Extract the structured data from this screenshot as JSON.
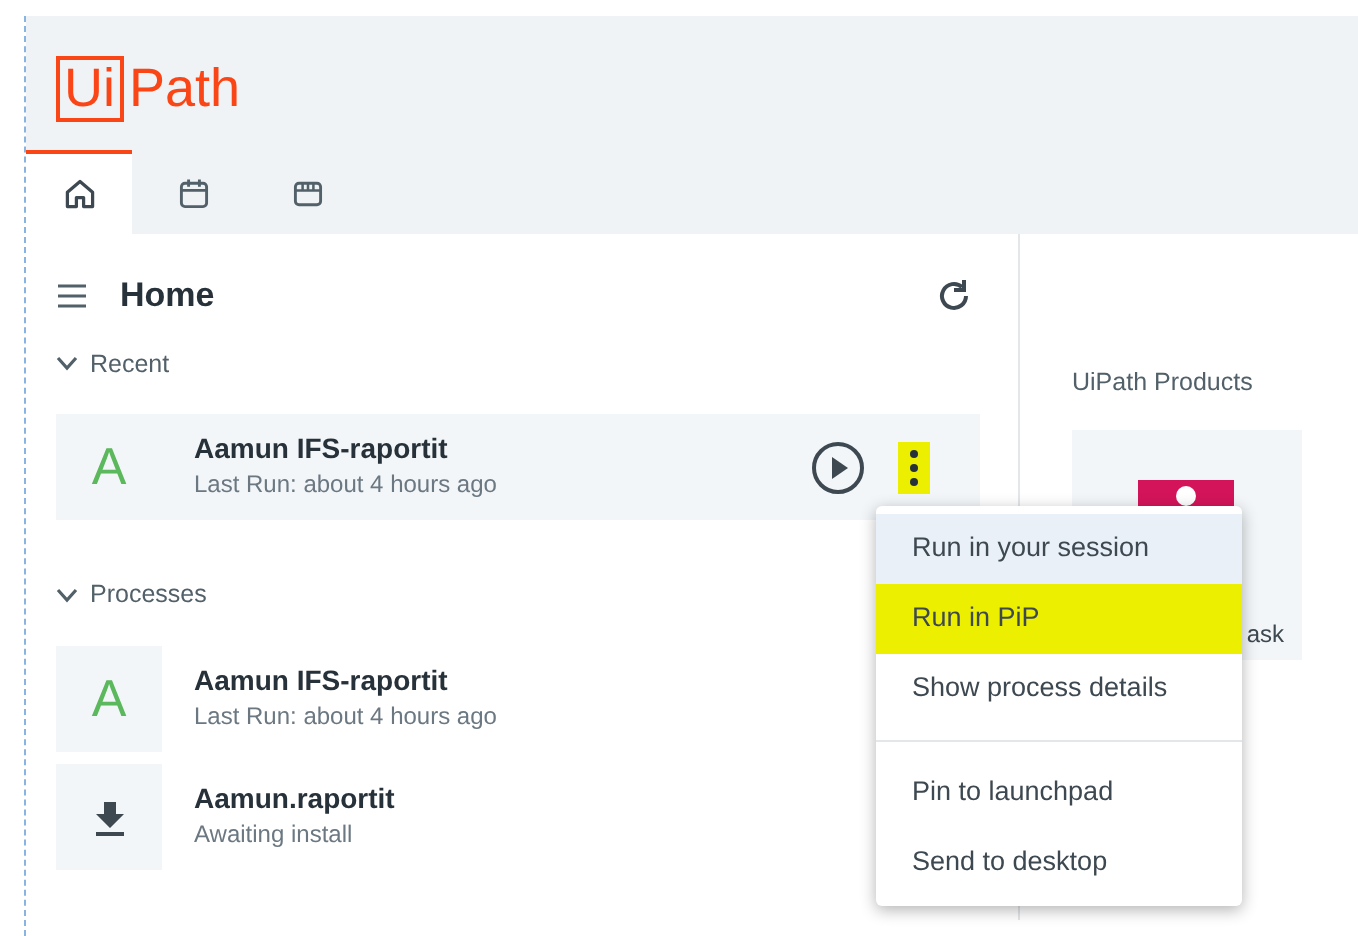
{
  "logo": {
    "boxed": "Ui",
    "rest": "Path"
  },
  "tabs": [
    {
      "kind": "home",
      "selected": true
    },
    {
      "kind": "calendar",
      "selected": false
    },
    {
      "kind": "store",
      "selected": false
    }
  ],
  "panel": {
    "title": "Home"
  },
  "sections": [
    {
      "title": "Recent",
      "expanded": true,
      "items": [
        {
          "kind": "process",
          "initial": "A",
          "name": "Aamun IFS-raportit",
          "detail": "Last Run: about 4 hours ago",
          "hovered": true,
          "menu_highlighted": true
        }
      ]
    },
    {
      "title": "Processes",
      "expanded": true,
      "items": [
        {
          "kind": "process",
          "initial": "A",
          "name": "Aamun IFS-raportit",
          "detail": "Last Run: about 4 hours ago",
          "hovered": false
        },
        {
          "kind": "install",
          "name": "Aamun.raportit",
          "detail": "Awaiting install",
          "hovered": false
        }
      ]
    }
  ],
  "products": {
    "title": "UiPath Products",
    "tiles": [
      {
        "label": "ask"
      }
    ]
  },
  "context_menu": {
    "groups": [
      [
        {
          "label": "Run in your session",
          "hovered": true,
          "highlighted": false
        },
        {
          "label": "Run in PiP",
          "hovered": false,
          "highlighted": true
        },
        {
          "label": "Show process details",
          "hovered": false,
          "highlighted": false
        }
      ],
      [
        {
          "label": "Pin to launchpad",
          "hovered": false,
          "highlighted": false
        },
        {
          "label": "Send to desktop",
          "hovered": false,
          "highlighted": false
        }
      ]
    ]
  }
}
